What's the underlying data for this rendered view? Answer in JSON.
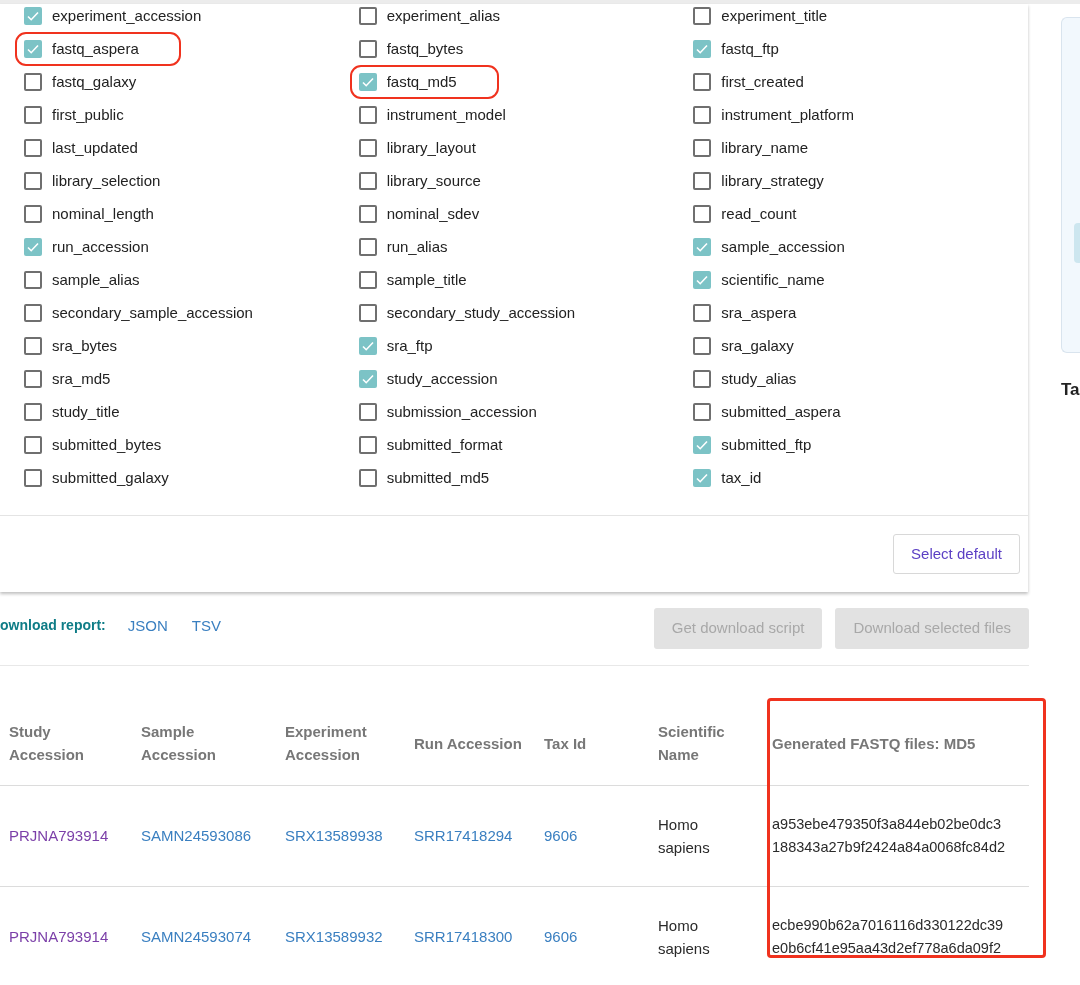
{
  "fields": [
    {
      "label": "experiment_accession",
      "checked": true,
      "highlighted": false
    },
    {
      "label": "experiment_alias",
      "checked": false,
      "highlighted": false
    },
    {
      "label": "experiment_title",
      "checked": false,
      "highlighted": false
    },
    {
      "label": "fastq_aspera",
      "checked": true,
      "highlighted": true
    },
    {
      "label": "fastq_bytes",
      "checked": false,
      "highlighted": false
    },
    {
      "label": "fastq_ftp",
      "checked": true,
      "highlighted": false
    },
    {
      "label": "fastq_galaxy",
      "checked": false,
      "highlighted": false
    },
    {
      "label": "fastq_md5",
      "checked": true,
      "highlighted": true
    },
    {
      "label": "first_created",
      "checked": false,
      "highlighted": false
    },
    {
      "label": "first_public",
      "checked": false,
      "highlighted": false
    },
    {
      "label": "instrument_model",
      "checked": false,
      "highlighted": false
    },
    {
      "label": "instrument_platform",
      "checked": false,
      "highlighted": false
    },
    {
      "label": "last_updated",
      "checked": false,
      "highlighted": false
    },
    {
      "label": "library_layout",
      "checked": false,
      "highlighted": false
    },
    {
      "label": "library_name",
      "checked": false,
      "highlighted": false
    },
    {
      "label": "library_selection",
      "checked": false,
      "highlighted": false
    },
    {
      "label": "library_source",
      "checked": false,
      "highlighted": false
    },
    {
      "label": "library_strategy",
      "checked": false,
      "highlighted": false
    },
    {
      "label": "nominal_length",
      "checked": false,
      "highlighted": false
    },
    {
      "label": "nominal_sdev",
      "checked": false,
      "highlighted": false
    },
    {
      "label": "read_count",
      "checked": false,
      "highlighted": false
    },
    {
      "label": "run_accession",
      "checked": true,
      "highlighted": false
    },
    {
      "label": "run_alias",
      "checked": false,
      "highlighted": false
    },
    {
      "label": "sample_accession",
      "checked": true,
      "highlighted": false
    },
    {
      "label": "sample_alias",
      "checked": false,
      "highlighted": false
    },
    {
      "label": "sample_title",
      "checked": false,
      "highlighted": false
    },
    {
      "label": "scientific_name",
      "checked": true,
      "highlighted": false
    },
    {
      "label": "secondary_sample_accession",
      "checked": false,
      "highlighted": false
    },
    {
      "label": "secondary_study_accession",
      "checked": false,
      "highlighted": false
    },
    {
      "label": "sra_aspera",
      "checked": false,
      "highlighted": false
    },
    {
      "label": "sra_bytes",
      "checked": false,
      "highlighted": false
    },
    {
      "label": "sra_ftp",
      "checked": true,
      "highlighted": false
    },
    {
      "label": "sra_galaxy",
      "checked": false,
      "highlighted": false
    },
    {
      "label": "sra_md5",
      "checked": false,
      "highlighted": false
    },
    {
      "label": "study_accession",
      "checked": true,
      "highlighted": false
    },
    {
      "label": "study_alias",
      "checked": false,
      "highlighted": false
    },
    {
      "label": "study_title",
      "checked": false,
      "highlighted": false
    },
    {
      "label": "submission_accession",
      "checked": false,
      "highlighted": false
    },
    {
      "label": "submitted_aspera",
      "checked": false,
      "highlighted": false
    },
    {
      "label": "submitted_bytes",
      "checked": false,
      "highlighted": false
    },
    {
      "label": "submitted_format",
      "checked": false,
      "highlighted": false
    },
    {
      "label": "submitted_ftp",
      "checked": true,
      "highlighted": false
    },
    {
      "label": "submitted_galaxy",
      "checked": false,
      "highlighted": false
    },
    {
      "label": "submitted_md5",
      "checked": false,
      "highlighted": false
    },
    {
      "label": "tax_id",
      "checked": true,
      "highlighted": false
    }
  ],
  "select_default_button": "Select default",
  "download_report": {
    "label": "ownload report:",
    "links": [
      "JSON",
      "TSV"
    ]
  },
  "action_buttons": [
    {
      "label": "Get download script",
      "disabled": true
    },
    {
      "label": "Download selected files",
      "disabled": true
    }
  ],
  "table": {
    "columns": [
      {
        "label": "Study Accession",
        "highlighted": false
      },
      {
        "label": "Sample Accession",
        "highlighted": false
      },
      {
        "label": "Experiment Accession",
        "highlighted": false
      },
      {
        "label": "Run Accession",
        "highlighted": false
      },
      {
        "label": "Tax Id",
        "highlighted": false
      },
      {
        "label": "Scientific Name",
        "highlighted": false
      },
      {
        "label": "Generated FASTQ files: MD5",
        "highlighted": true
      }
    ],
    "rows": [
      [
        {
          "kind": "visited_link",
          "lines": [
            "PRJNA793914"
          ]
        },
        {
          "kind": "link",
          "lines": [
            "SAMN24593086"
          ]
        },
        {
          "kind": "link",
          "lines": [
            "SRX13589938"
          ]
        },
        {
          "kind": "link",
          "lines": [
            "SRR17418294"
          ]
        },
        {
          "kind": "link",
          "lines": [
            "9606"
          ]
        },
        {
          "kind": "text",
          "lines": [
            "Homo sapiens"
          ]
        },
        {
          "kind": "text",
          "lines": [
            "a953ebe479350f3a844eb02be0dc3",
            "188343a27b9f2424a84a0068fc84d2"
          ]
        }
      ],
      [
        {
          "kind": "visited_link",
          "lines": [
            "PRJNA793914"
          ]
        },
        {
          "kind": "link",
          "lines": [
            "SAMN24593074"
          ]
        },
        {
          "kind": "link",
          "lines": [
            "SRX13589932"
          ]
        },
        {
          "kind": "link",
          "lines": [
            "SRR17418300"
          ]
        },
        {
          "kind": "link",
          "lines": [
            "9606"
          ]
        },
        {
          "kind": "text",
          "lines": [
            "Homo sapiens"
          ]
        },
        {
          "kind": "text",
          "lines": [
            "ecbe990b62a7016116d330122dc39",
            "e0b6cf41e95aa43d2ef778a6da09f2"
          ]
        }
      ]
    ]
  },
  "side_heading": "Ta"
}
